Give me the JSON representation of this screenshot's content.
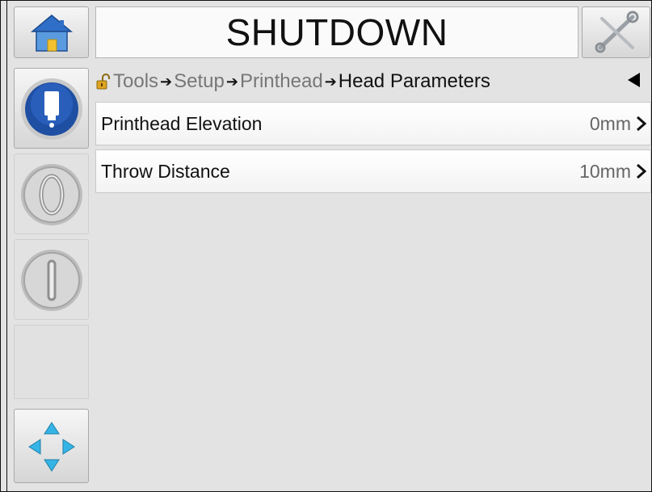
{
  "header": {
    "title": "SHUTDOWN",
    "home_icon": "home-icon",
    "tools_icon": "wrench-screwdriver-icon"
  },
  "sidebar": {
    "items": [
      {
        "icon": "ink-cartridge-icon"
      },
      {
        "icon": "stop-o-icon"
      },
      {
        "icon": "start-i-icon"
      },
      {
        "icon": ""
      },
      {
        "icon": "navigation-arrows-icon"
      }
    ]
  },
  "breadcrumb": {
    "lock_icon": "unlocked-padlock-icon",
    "items": [
      "Tools",
      "Setup",
      "Printhead",
      "Head Parameters"
    ],
    "back_icon": "back-arrow-icon"
  },
  "parameters": [
    {
      "label": "Printhead Elevation",
      "value": "0mm"
    },
    {
      "label": "Throw Distance",
      "value": "10mm"
    }
  ],
  "colors": {
    "background": "#e3e3e3",
    "accent_blue": "#1f4fa3",
    "home_blue": "#2f6fc7",
    "home_yellow": "#f2c230"
  }
}
